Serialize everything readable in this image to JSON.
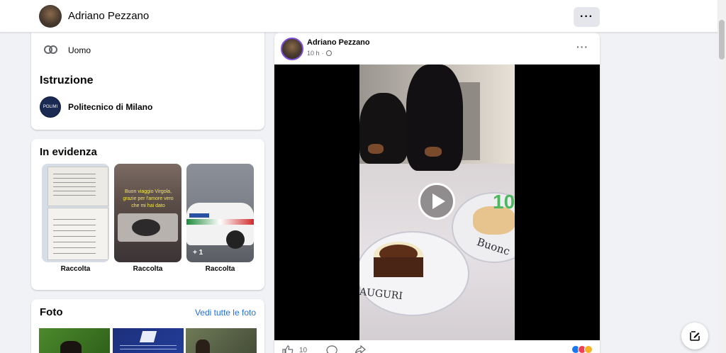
{
  "header": {
    "profile_name": "Adriano Pezzano"
  },
  "about": {
    "gender": "Uomo",
    "education_heading": "Istruzione",
    "school_name": "Politecnico di Milano",
    "school_logo_text": "POLIMI"
  },
  "highlights": {
    "heading": "In evidenza",
    "items": [
      {
        "label": "Raccolta",
        "overlay_text": ""
      },
      {
        "label": "Raccolta",
        "overlay_text": "Buon viaggio Virgola, grazie per l'amore vero che mi hai dato"
      },
      {
        "label": "Raccolta",
        "badge": "+ 1"
      }
    ]
  },
  "photos": {
    "heading": "Foto",
    "see_all": "Vedi tutte le foto"
  },
  "post": {
    "author": "Adriano Pezzano",
    "time": "10 h",
    "separator": "·",
    "like_count": "10",
    "cake_number": "10",
    "plate_text": "Buonc",
    "plate_text_2": "AUGURI"
  },
  "colors": {
    "link": "#216fdb",
    "accent": "#7b4fd6"
  }
}
